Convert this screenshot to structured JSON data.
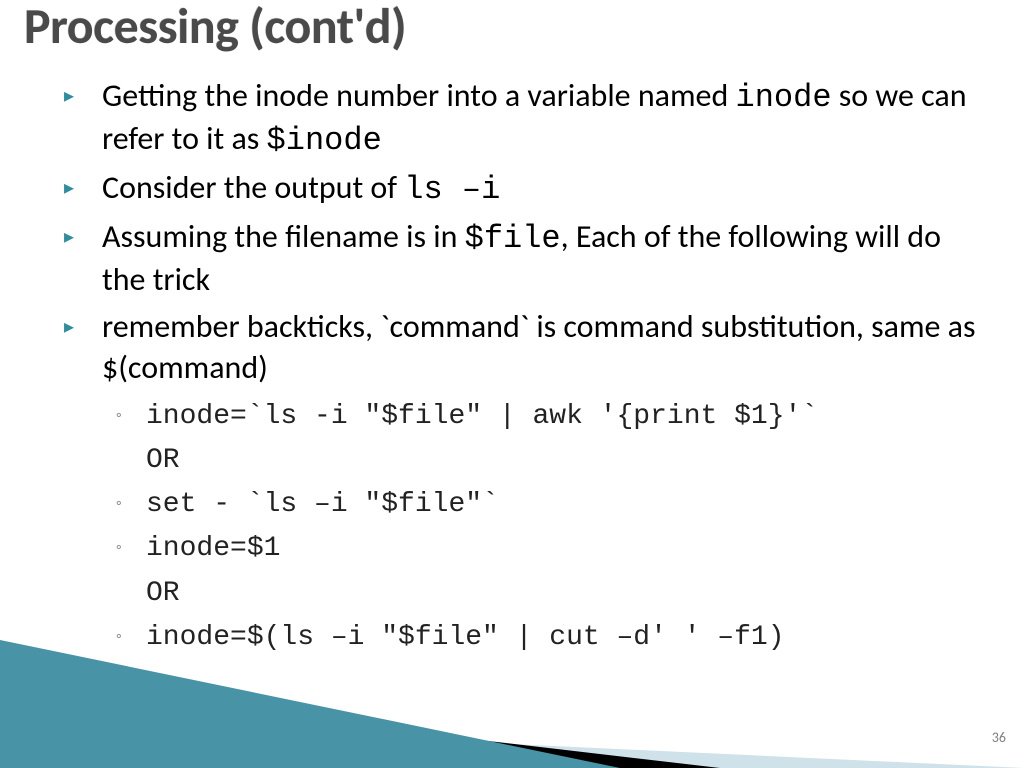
{
  "title": "Processing (cont'd)",
  "bullets": [
    {
      "pre": "Getting the inode number into a variable named ",
      "code1": "inode",
      "mid": " so we can refer to it as ",
      "code2": "$inode"
    },
    {
      "pre": "Consider the output of ",
      "code1": "ls –i"
    },
    {
      "pre": "Assuming the filename is in ",
      "code1": "$file",
      "post": ", Each of the following will do the trick"
    },
    {
      "pre": "remember backticks, `command` is command substitution, same as $(command)"
    }
  ],
  "sub": [
    "inode=`ls -i \"$file\" | awk '{print $1}'`",
    "set - `ls –i \"$file\"`",
    "inode=$1",
    "inode=$(ls –i \"$file\" | cut –d' ' –f1)"
  ],
  "or": "OR",
  "page": "36",
  "accent": "#3a8a9e"
}
